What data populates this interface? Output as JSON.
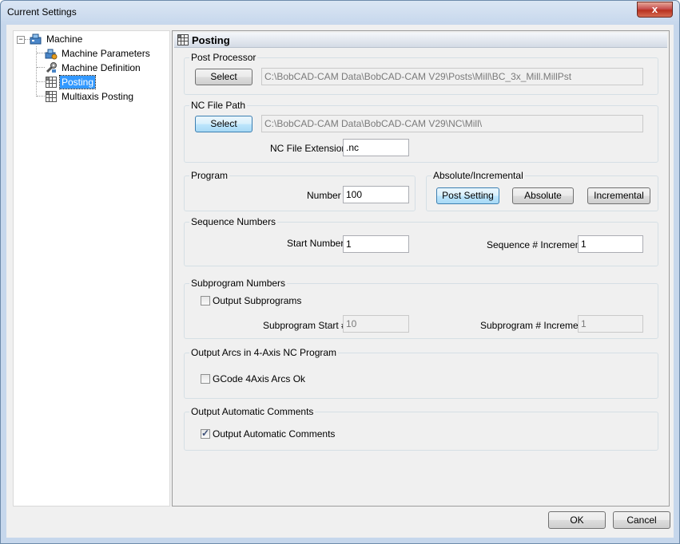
{
  "window": {
    "title": "Current Settings",
    "close_glyph": "x"
  },
  "tree": {
    "root": {
      "label": "Machine",
      "icon": "machine-icon",
      "expander": "−"
    },
    "items": [
      {
        "label": "Machine Parameters",
        "icon": "machine-parameters-icon"
      },
      {
        "label": "Machine Definition",
        "icon": "wrench-icon"
      },
      {
        "label": "Posting",
        "icon": "grid-icon",
        "selected": true
      },
      {
        "label": "Multiaxis Posting",
        "icon": "grid-icon"
      }
    ]
  },
  "panel": {
    "title": "Posting",
    "icon": "grid-icon"
  },
  "post_processor": {
    "group_label": "Post Processor",
    "select_label": "Select",
    "path": "C:\\BobCAD-CAM Data\\BobCAD-CAM V29\\Posts\\Mill\\BC_3x_Mill.MillPst"
  },
  "nc_file_path": {
    "group_label": "NC File Path",
    "select_label": "Select",
    "path": "C:\\BobCAD-CAM Data\\BobCAD-CAM V29\\NC\\Mill\\",
    "extension_label": "NC File Extension",
    "extension_value": ".nc"
  },
  "program": {
    "group_label": "Program",
    "number_label": "Number",
    "number_value": "100"
  },
  "absolute_incremental": {
    "group_label": "Absolute/Incremental",
    "buttons": [
      "Post Setting",
      "Absolute",
      "Incremental"
    ]
  },
  "sequence_numbers": {
    "group_label": "Sequence Numbers",
    "start_label": "Start Number",
    "start_value": "1",
    "increment_label": "Sequence # Increment",
    "increment_value": "1"
  },
  "subprogram_numbers": {
    "group_label": "Subprogram Numbers",
    "output_checkbox_label": "Output Subprograms",
    "output_checked": false,
    "start_label": "Subprogram Start #",
    "start_value": "10",
    "increment_label": "Subprogram # Increment",
    "increment_value": "1"
  },
  "output_arcs": {
    "group_label": "Output Arcs in 4-Axis NC Program",
    "checkbox_label": "GCode 4Axis Arcs Ok",
    "checked": false
  },
  "output_comments": {
    "group_label": "Output Automatic Comments",
    "checkbox_label": "Output Automatic Comments",
    "checked": true,
    "check_glyph": "✓"
  },
  "footer": {
    "ok_label": "OK",
    "cancel_label": "Cancel"
  }
}
